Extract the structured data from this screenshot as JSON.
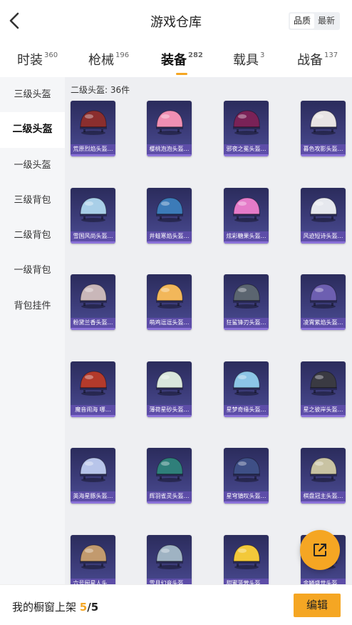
{
  "header": {
    "title": "游戏仓库",
    "back_icon": "chevron-left-icon"
  },
  "sort": {
    "options": [
      "品质",
      "最新"
    ],
    "selected": "品质"
  },
  "tabs": [
    {
      "label": "时装",
      "count": "360",
      "active": false
    },
    {
      "label": "枪械",
      "count": "196",
      "active": false
    },
    {
      "label": "装备",
      "count": "282",
      "active": true
    },
    {
      "label": "载具",
      "count": "3",
      "active": false
    },
    {
      "label": "战备",
      "count": "137",
      "active": false
    }
  ],
  "sidebar": {
    "items": [
      {
        "label": "三级头盔",
        "active": false
      },
      {
        "label": "二级头盔",
        "active": true
      },
      {
        "label": "一级头盔",
        "active": false
      },
      {
        "label": "三级背包",
        "active": false
      },
      {
        "label": "二级背包",
        "active": false
      },
      {
        "label": "一级背包",
        "active": false
      },
      {
        "label": "背包挂件",
        "active": false
      }
    ]
  },
  "content": {
    "category_title": "二级头盔: 36件",
    "items": [
      {
        "name": "荒原烈焰头盔…",
        "color": "#8b2e2e"
      },
      {
        "name": "樱桃泡泡头盔…",
        "color": "#f08fb3"
      },
      {
        "name": "邪夜之冕头盔…",
        "color": "#7a2257"
      },
      {
        "name": "暮色攻影头盔…",
        "color": "#e8e4e4"
      },
      {
        "name": "雪国风尚头盔…",
        "color": "#a9cfe8"
      },
      {
        "name": "井蛙寒焰头盔…",
        "color": "#3c7bb8"
      },
      {
        "name": "炫彩糖果头盔…",
        "color": "#e57bc9"
      },
      {
        "name": "风迹短诗头盔…",
        "color": "#e6e8ee"
      },
      {
        "name": "粉黛兰香头盔…",
        "color": "#c9b7b9"
      },
      {
        "name": "萌鸡逗逗头盔…",
        "color": "#f2b75a"
      },
      {
        "name": "狂鲨锋刃头盔…",
        "color": "#5b6570"
      },
      {
        "name": "凌霄紫焰头盔…",
        "color": "#6d5fb1"
      },
      {
        "name": "魔音闹海 哪…",
        "color": "#b33a2b"
      },
      {
        "name": "薄荷星砂头盔…",
        "color": "#d9e6dc"
      },
      {
        "name": "星梦奇缘头盔…",
        "color": "#8cc5e6"
      },
      {
        "name": "星之彼岸头盔…",
        "color": "#3a3a42"
      },
      {
        "name": "英海星豚头盔…",
        "color": "#b8c5ea"
      },
      {
        "name": "辉羽雀灵头盔…",
        "color": "#2f7f7a"
      },
      {
        "name": "星穹镇叹头盔…",
        "color": "#3e4f86"
      },
      {
        "name": "棋盘冠主头盔…",
        "color": "#c9c3a3"
      },
      {
        "name": "六号厨星人头…",
        "color": "#c29a6e"
      },
      {
        "name": "雪月幻音头盔…",
        "color": "#9fb3c3"
      },
      {
        "name": "甜蜜菠萝头盔…",
        "color": "#f3c93a"
      },
      {
        "name": "金鳞盛世头盔…",
        "color": "#b8893b"
      }
    ]
  },
  "fab": {
    "icon": "share-external-icon"
  },
  "bottom": {
    "label": "我的橱窗上架",
    "current": "5",
    "separator": "/",
    "total": "5",
    "edit_label": "编辑"
  },
  "colors": {
    "accent": "#f5a623",
    "card_bg": "#35357a",
    "label_bg": "#5f4eaa"
  }
}
